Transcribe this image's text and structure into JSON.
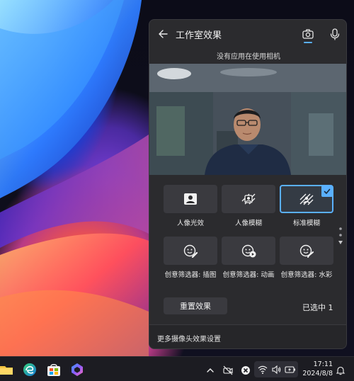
{
  "panel": {
    "title": "工作室效果",
    "status": "没有应用在使用相机",
    "effects": [
      {
        "label": "人像光效",
        "selected": false
      },
      {
        "label": "人像模糊",
        "selected": false
      },
      {
        "label": "标准模糊",
        "selected": true
      },
      {
        "label": "创意筛选器: 插图",
        "selected": false
      },
      {
        "label": "创意筛选器: 动画",
        "selected": false
      },
      {
        "label": "创意筛选器: 水彩",
        "selected": false
      }
    ],
    "reset_label": "重置效果",
    "selected_count": "已选中 1",
    "footer_link": "更多摄像头效果设置"
  },
  "taskbar": {
    "time": "17:11",
    "date": "2024/8/8",
    "apps": [
      "file-explorer-icon",
      "edge-icon",
      "store-icon",
      "copilot-icon"
    ]
  },
  "colors": {
    "accent": "#5ab0ff",
    "panel_bg": "#2b2b2e",
    "tile_bg": "#3a3a3f"
  }
}
